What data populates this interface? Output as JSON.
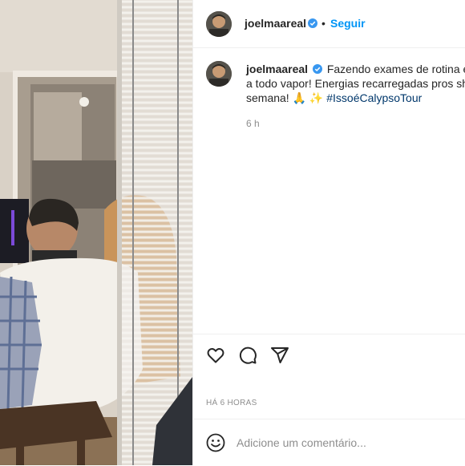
{
  "post": {
    "username": "joelmaareal",
    "follow_label": "Seguir",
    "separator": "•"
  },
  "caption": {
    "username": "joelmaareal",
    "line1": "Fazendo exames de rotina en",
    "line2": "a todo vapor! Energias recarregadas pros sho",
    "line3_prefix": "semana! 🙏 ✨ ",
    "hashtag": "#IssoéCalypsoTour",
    "time": "6 h"
  },
  "actions": {
    "icons": [
      "heart-icon",
      "comment-icon",
      "share-icon"
    ],
    "date": "HÁ 6 HORAS"
  },
  "comment": {
    "placeholder": "Adicione um comentário..."
  },
  "colors": {
    "accent": "#0095f6",
    "verified": "#3897f0",
    "hashtag": "#00376b"
  }
}
